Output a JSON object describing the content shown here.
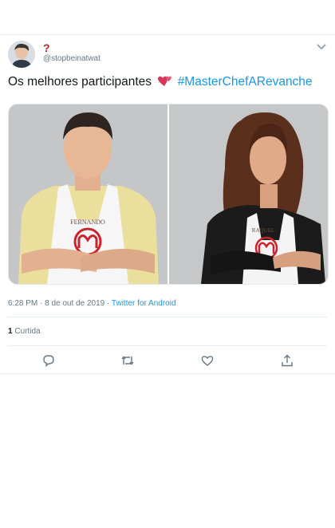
{
  "tweet": {
    "display_name": "?",
    "handle": "@stopbeinatwat",
    "text_before": "Os melhores participantes",
    "emoji": "two-hearts-emoji",
    "hashtag": "#MasterChefARevanche",
    "photos": [
      {
        "apron_name": "FERNANDO"
      },
      {
        "apron_name": "RAQUEL"
      }
    ],
    "timestamp": "6:28 PM · 8 de out de 2019",
    "separator": " · ",
    "source": "Twitter for Android",
    "likes_count": "1",
    "likes_label": "Curtida"
  },
  "actions": {
    "reply_icon": "reply-icon",
    "retweet_icon": "retweet-icon",
    "like_icon": "like-icon",
    "share_icon": "share-icon"
  },
  "colors": {
    "accent": "#1b95e0",
    "name_red": "#b0242c",
    "secondary_text": "#657786",
    "divider": "#e6ecf0"
  }
}
